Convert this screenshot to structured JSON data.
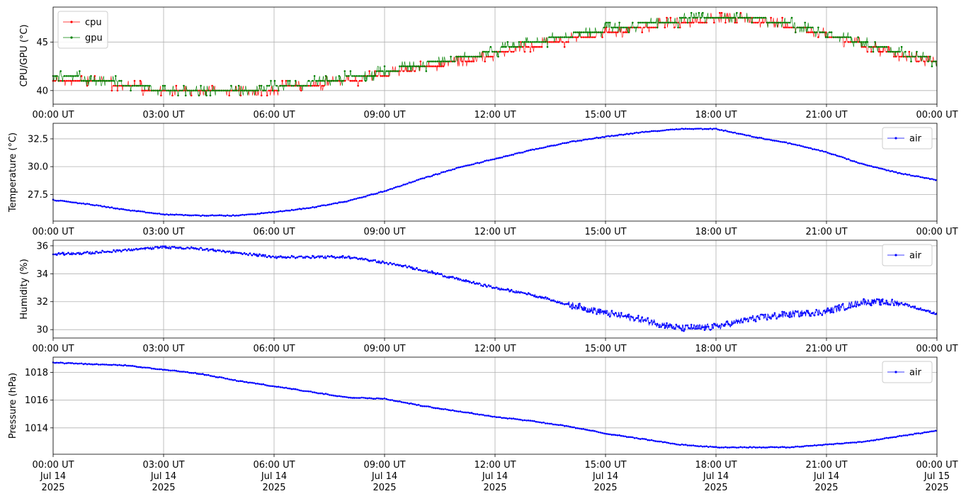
{
  "chart_data": [
    {
      "type": "line",
      "ylabel": "CPU/GPU (°C)",
      "xlim": [
        "00:00",
        "24:00"
      ],
      "ylim": [
        38.6,
        48.6
      ],
      "yticks": [
        40,
        45
      ],
      "xticks": [
        "00:00 UT",
        "03:00 UT",
        "06:00 UT",
        "09:00 UT",
        "12:00 UT",
        "15:00 UT",
        "18:00 UT",
        "21:00 UT",
        "00:00 UT"
      ],
      "grid": true,
      "legend_position": "top-left",
      "series": [
        {
          "name": "cpu",
          "color": "#ff0000",
          "x_hours": [
            0,
            1.5,
            2.5,
            3.5,
            4.5,
            5.5,
            6.5,
            7.5,
            8.5,
            9.5,
            10.5,
            11.5,
            12.5,
            13.5,
            14.5,
            15.5,
            16.5,
            17.5,
            18.5,
            19.5,
            20.5,
            21.5,
            22.5,
            23.5,
            24
          ],
          "values": [
            41.2,
            40.8,
            40.2,
            40.0,
            39.9,
            40.0,
            40.4,
            40.8,
            41.3,
            42.0,
            42.7,
            43.3,
            44.2,
            44.9,
            45.6,
            46.2,
            46.8,
            47.2,
            47.4,
            47.0,
            46.2,
            45.2,
            44.2,
            43.2,
            43.0
          ]
        },
        {
          "name": "gpu",
          "color": "#008000",
          "x_hours": [
            0,
            1.5,
            2.5,
            3.5,
            4.5,
            5.5,
            6.5,
            7.5,
            8.5,
            9.5,
            10.5,
            11.5,
            12.5,
            13.5,
            14.5,
            15.5,
            16.5,
            17.5,
            18.5,
            19.5,
            20.5,
            21.5,
            22.5,
            23.5,
            24
          ],
          "values": [
            41.5,
            41.0,
            40.3,
            40.0,
            40.0,
            40.1,
            40.6,
            41.0,
            41.6,
            42.3,
            43.0,
            43.6,
            44.6,
            45.3,
            46.0,
            46.6,
            47.0,
            47.5,
            47.6,
            47.2,
            46.4,
            45.4,
            44.4,
            43.4,
            43.1
          ]
        }
      ]
    },
    {
      "type": "line",
      "ylabel": "Temperature (°C)",
      "xlim": [
        "00:00",
        "24:00"
      ],
      "ylim": [
        25.1,
        33.9
      ],
      "yticks": [
        "27.5",
        "30.0",
        "32.5"
      ],
      "xticks": [
        "00:00 UT",
        "03:00 UT",
        "06:00 UT",
        "09:00 UT",
        "12:00 UT",
        "15:00 UT",
        "18:00 UT",
        "21:00 UT",
        "00:00 UT"
      ],
      "grid": true,
      "legend_position": "top-right",
      "series": [
        {
          "name": "air",
          "color": "#0000ff",
          "x_hours": [
            0,
            1,
            2,
            3,
            4,
            5,
            6,
            7,
            8,
            9,
            10,
            11,
            12,
            13,
            14,
            15,
            16,
            17,
            18,
            19,
            20,
            21,
            22,
            23,
            24
          ],
          "values": [
            27.0,
            26.6,
            26.1,
            25.7,
            25.6,
            25.6,
            25.9,
            26.3,
            26.9,
            27.8,
            28.9,
            29.9,
            30.7,
            31.5,
            32.2,
            32.7,
            33.1,
            33.4,
            33.4,
            32.7,
            32.1,
            31.3,
            30.2,
            29.4,
            28.8
          ]
        }
      ]
    },
    {
      "type": "line",
      "ylabel": "Humidity (%)",
      "xlim": [
        "00:00",
        "24:00"
      ],
      "ylim": [
        29.4,
        36.4
      ],
      "yticks": [
        30,
        32,
        34,
        36
      ],
      "xticks": [
        "00:00 UT",
        "03:00 UT",
        "06:00 UT",
        "09:00 UT",
        "12:00 UT",
        "15:00 UT",
        "18:00 UT",
        "21:00 UT",
        "00:00 UT"
      ],
      "grid": true,
      "legend_position": "top-right",
      "series": [
        {
          "name": "air",
          "color": "#0000ff",
          "x_hours": [
            0,
            1,
            2,
            3,
            4,
            5,
            6,
            7,
            8,
            9,
            10,
            11,
            12,
            13,
            14,
            15,
            16,
            17,
            18,
            19,
            20,
            21,
            22,
            23,
            24
          ],
          "values": [
            35.4,
            35.5,
            35.7,
            35.9,
            35.8,
            35.5,
            35.2,
            35.2,
            35.2,
            34.8,
            34.3,
            33.6,
            33.0,
            32.5,
            31.8,
            31.2,
            30.7,
            30.1,
            30.2,
            30.8,
            31.1,
            31.3,
            32.0,
            31.9,
            31.1
          ]
        }
      ]
    },
    {
      "type": "line",
      "ylabel": "Pressure (hPa)",
      "xlim": [
        "2025-07-14 00:00",
        "2025-07-15 00:00"
      ],
      "ylim": [
        1012.1,
        1019.1
      ],
      "yticks": [
        1014,
        1016,
        1018
      ],
      "xticks": [
        {
          "time": "00:00 UT",
          "day": "Jul 14",
          "year": "2025"
        },
        {
          "time": "03:00 UT",
          "day": "Jul 14",
          "year": "2025"
        },
        {
          "time": "06:00 UT",
          "day": "Jul 14",
          "year": "2025"
        },
        {
          "time": "09:00 UT",
          "day": "Jul 14",
          "year": "2025"
        },
        {
          "time": "12:00 UT",
          "day": "Jul 14",
          "year": "2025"
        },
        {
          "time": "15:00 UT",
          "day": "Jul 14",
          "year": "2025"
        },
        {
          "time": "18:00 UT",
          "day": "Jul 14",
          "year": "2025"
        },
        {
          "time": "21:00 UT",
          "day": "Jul 14",
          "year": "2025"
        },
        {
          "time": "00:00 UT",
          "day": "Jul 15",
          "year": "2025"
        }
      ],
      "grid": true,
      "legend_position": "top-right",
      "series": [
        {
          "name": "air",
          "color": "#0000ff",
          "x_hours": [
            0,
            1,
            2,
            3,
            4,
            5,
            6,
            7,
            8,
            9,
            10,
            11,
            12,
            13,
            14,
            15,
            16,
            17,
            18,
            19,
            20,
            21,
            22,
            23,
            24
          ],
          "values": [
            1018.7,
            1018.6,
            1018.5,
            1018.2,
            1017.9,
            1017.4,
            1017.0,
            1016.6,
            1016.2,
            1016.1,
            1015.6,
            1015.2,
            1014.8,
            1014.5,
            1014.1,
            1013.6,
            1013.2,
            1012.8,
            1012.6,
            1012.6,
            1012.6,
            1012.8,
            1013.0,
            1013.4,
            1013.8
          ]
        }
      ]
    }
  ]
}
